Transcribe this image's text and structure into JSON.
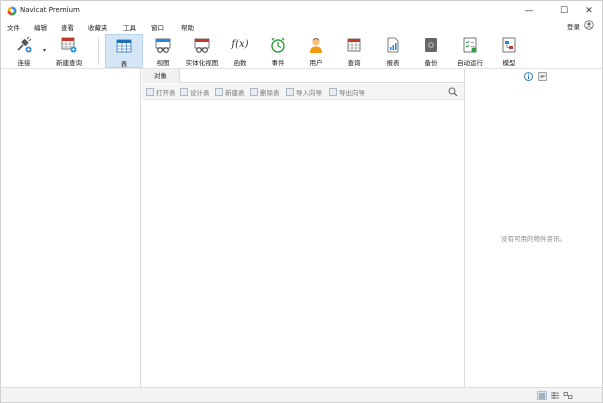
{
  "window": {
    "title": "Navicat Premium"
  },
  "window_controls": {
    "minimize": "—",
    "maximize": "☐",
    "close": "✕"
  },
  "menu": [
    "文件",
    "编辑",
    "查看",
    "收藏夹",
    "工具",
    "窗口",
    "帮助"
  ],
  "login_label": "登录",
  "toolbar": {
    "items": [
      {
        "label": "连接",
        "icon": "connection-icon"
      },
      {
        "label": "新建查询",
        "icon": "new-query-icon"
      },
      {
        "label": "表",
        "icon": "table-icon",
        "active": true
      },
      {
        "label": "视图",
        "icon": "view-icon"
      },
      {
        "label": "实体化视图",
        "icon": "materialized-view-icon"
      },
      {
        "label": "函数",
        "icon": "function-icon"
      },
      {
        "label": "事件",
        "icon": "event-icon"
      },
      {
        "label": "用户",
        "icon": "user-icon"
      },
      {
        "label": "查询",
        "icon": "query-icon"
      },
      {
        "label": "报表",
        "icon": "report-icon"
      },
      {
        "label": "备份",
        "icon": "backup-icon"
      },
      {
        "label": "自动运行",
        "icon": "automation-icon"
      },
      {
        "label": "模型",
        "icon": "model-icon"
      }
    ],
    "function_symbol": "f(x)"
  },
  "object_tab": "对象",
  "object_toolbar": [
    "打开表",
    "设计表",
    "新建表",
    "删除表",
    "导入向导",
    "导出向导"
  ],
  "info_pane": {
    "message": "没有可用的物件资讯。"
  },
  "colors": {
    "accent": "#1e88e5",
    "active_bg": "#d5e6f6",
    "divider": "#dcdcdc"
  }
}
